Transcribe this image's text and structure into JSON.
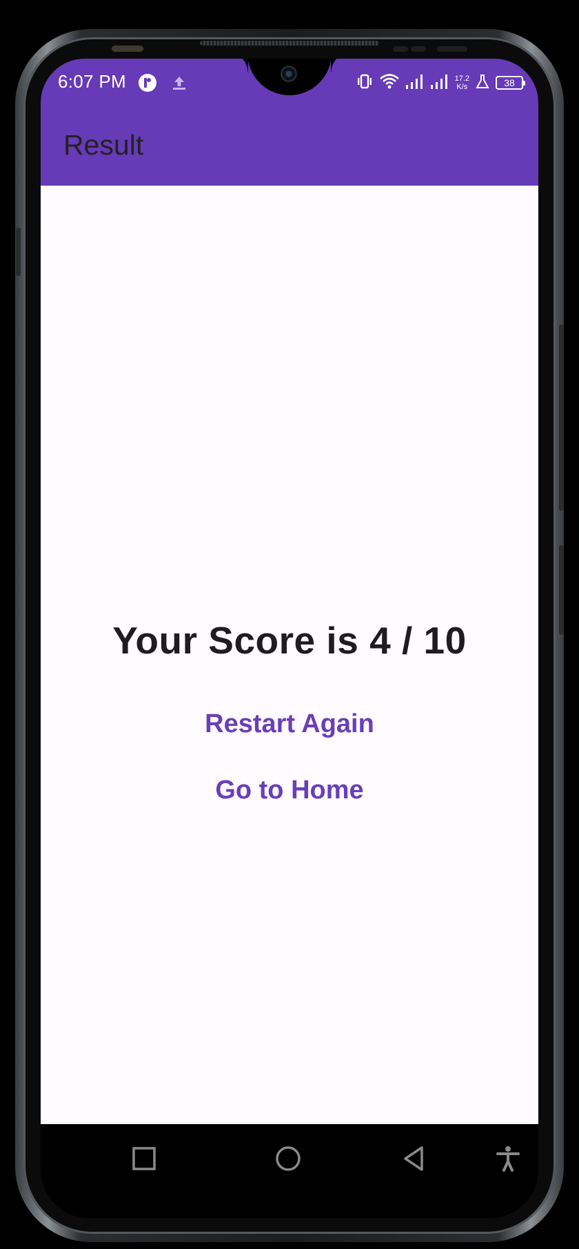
{
  "status_bar": {
    "time": "6:07 PM",
    "network_speed_value": "17.2",
    "network_speed_unit": "K/s",
    "battery_level": "38"
  },
  "toolbar": {
    "title": "Result"
  },
  "result": {
    "score_text": "Your Score is 4 / 10",
    "restart_label": "Restart Again",
    "home_label": "Go to Home"
  },
  "colors": {
    "primary": "#673ab7",
    "accent_text": "#6a3eb8",
    "background": "#fffbff",
    "score_text": "#1f1b20"
  },
  "icons": {
    "status_left": [
      "app-notification-icon",
      "upload-icon"
    ],
    "status_right": [
      "vibrate-icon",
      "wifi-icon",
      "signal-icon",
      "signal-icon",
      "network-speed",
      "lab-icon",
      "battery-icon"
    ],
    "nav": [
      "recents-icon",
      "home-icon",
      "back-icon",
      "accessibility-icon"
    ]
  }
}
